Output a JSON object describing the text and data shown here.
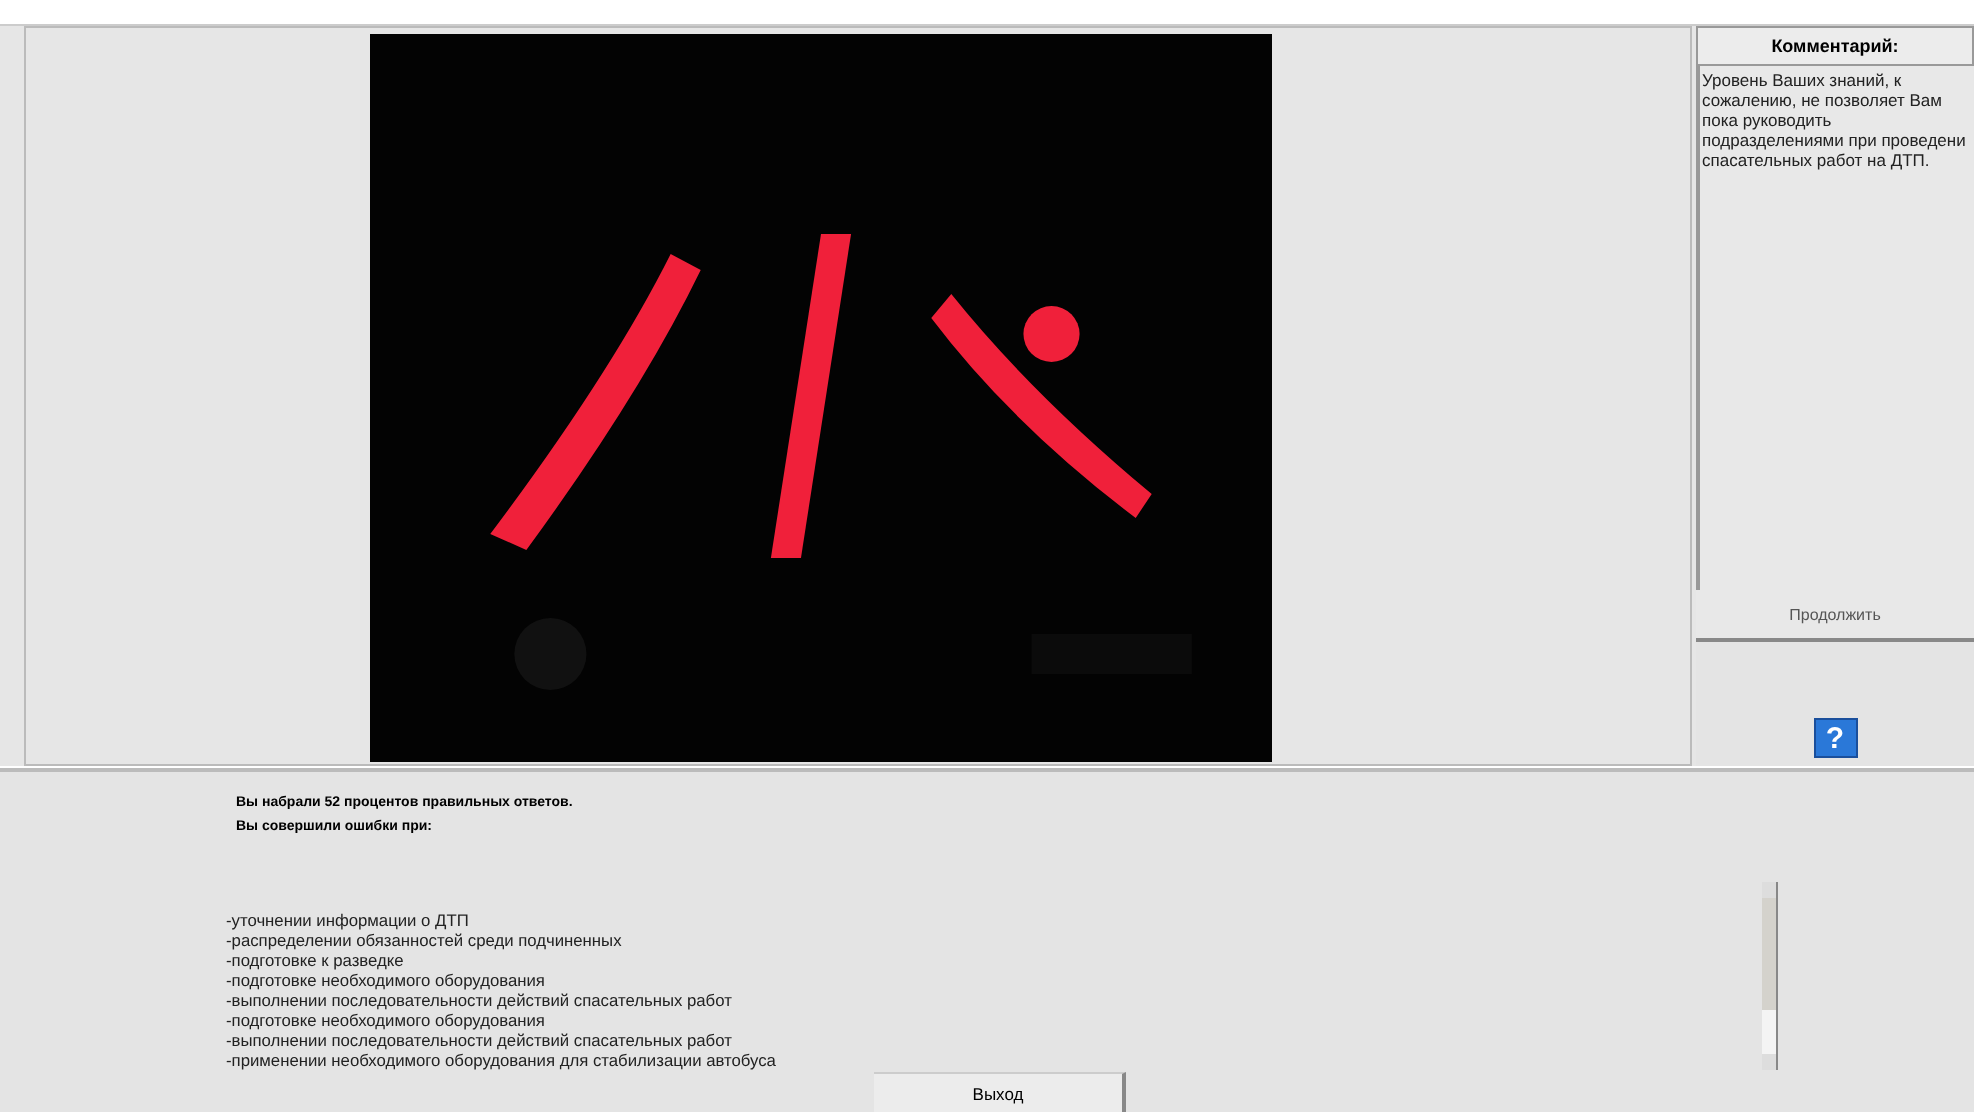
{
  "comment_panel": {
    "title": "Комментарий:",
    "text": "Уровень Ваших знаний, к\nсожалению, не позволяет Вам\nпока руководить\nподразделениями при проведени\nспасательных работ на ДТП.",
    "continue_button": "Продолжить",
    "help_button": "?"
  },
  "result": {
    "score_line": "Вы набрали 52 процентов правильных ответов.",
    "errors_heading": "Вы совершили ошибки при:",
    "errors": [
      "-уточнении информации о ДТП",
      "-распределении обязанностей среди подчиненных",
      "-подготовке к разведке",
      "-подготовке необходимого оборудования",
      "-выполнении последовательности действий спасательных работ",
      "-подготовке необходимого оборудования",
      "-выполнении последовательности действий спасательных работ",
      "-применении необходимого оборудования для стабилизации автобуса"
    ]
  },
  "exit_button": "Выход"
}
